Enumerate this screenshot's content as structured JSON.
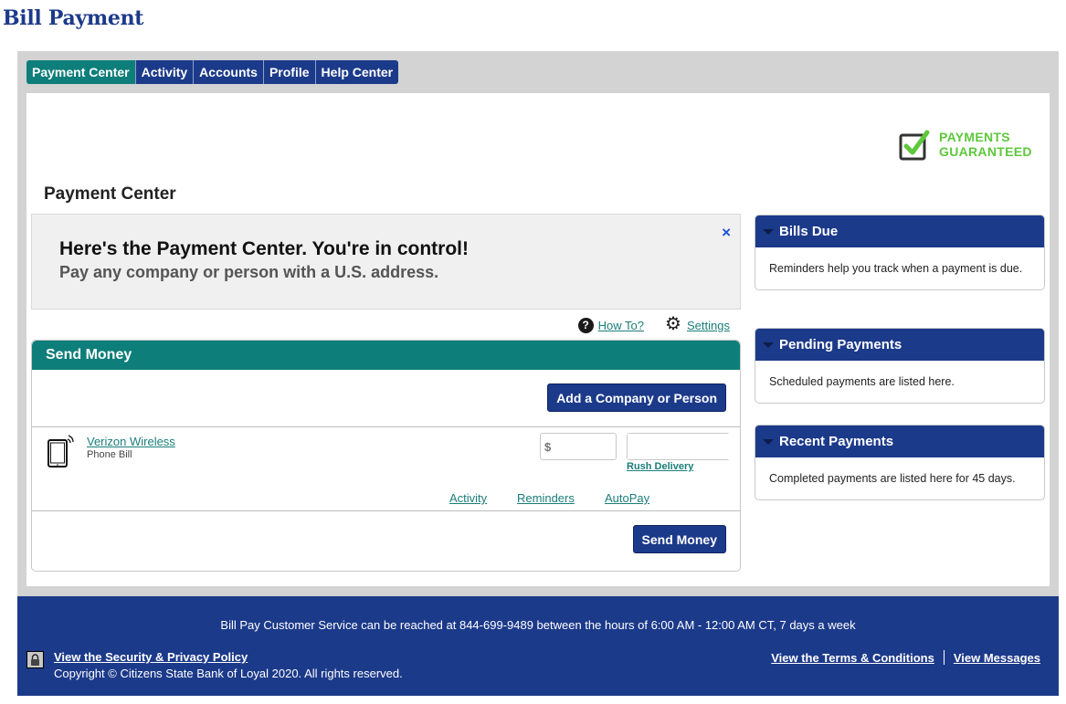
{
  "page": {
    "title": "Bill Payment"
  },
  "nav": {
    "tabs": [
      {
        "label": "Payment Center",
        "active": true
      },
      {
        "label": "Activity",
        "active": false
      },
      {
        "label": "Accounts",
        "active": false
      },
      {
        "label": "Profile",
        "active": false
      },
      {
        "label": "Help Center",
        "active": false
      }
    ]
  },
  "badge": {
    "line1": "PAYMENTS",
    "line2": "GUARANTEED",
    "icon": "checkbox-check-icon"
  },
  "main": {
    "section_title": "Payment Center",
    "banner": {
      "headline": "Here's the Payment Center. You're in control!",
      "subline": "Pay any company or person with a U.S. address.",
      "close_icon": "×"
    },
    "help": {
      "how_to": "How To?",
      "settings": "Settings"
    },
    "send_money": {
      "header": "Send Money",
      "add_button": "Add a Company or Person",
      "payees": [
        {
          "name": "Verizon Wireless",
          "category": "Phone Bill",
          "amount_placeholder": "$",
          "date_value": "",
          "rush_label": "Rush Delivery",
          "links": [
            "Activity",
            "Reminders",
            "AutoPay"
          ]
        }
      ],
      "submit_button": "Send Money"
    }
  },
  "sidebar": {
    "panels": [
      {
        "title": "Bills Due",
        "body": "Reminders help you track when a payment is due."
      },
      {
        "title": "Pending Payments",
        "body": "Scheduled payments are listed here."
      },
      {
        "title": "Recent Payments",
        "body": "Completed payments are listed here for 45 days."
      }
    ]
  },
  "footer": {
    "service": "Bill Pay Customer Service can be reached at 844-699-9489 between the hours of 6:00 AM - 12:00 AM CT, 7 days a week",
    "privacy_link": "View the Security & Privacy Policy",
    "copyright": "Copyright © Citizens State Bank of Loyal 2020. All rights reserved.",
    "terms_link": "View the Terms & Conditions",
    "messages_link": "View Messages"
  },
  "colors": {
    "brand_blue": "#1c3a8a",
    "teal": "#0e7e7a",
    "guarantee_green": "#5ec73c"
  }
}
